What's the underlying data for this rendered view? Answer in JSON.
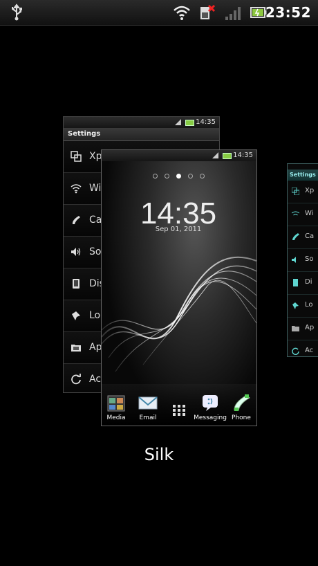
{
  "status_bar": {
    "time": "23:52"
  },
  "recent_apps": {
    "settings_card": {
      "status_time": "14:35",
      "title": "Settings",
      "items": [
        {
          "label": "Xp",
          "icon": "xperia-icon"
        },
        {
          "label": "Wi",
          "icon": "wifi-icon"
        },
        {
          "label": "Ca",
          "icon": "call-icon"
        },
        {
          "label": "So",
          "icon": "sound-icon"
        },
        {
          "label": "Dis",
          "icon": "display-icon"
        },
        {
          "label": "Lo",
          "icon": "location-icon"
        },
        {
          "label": "Ap",
          "icon": "apps-icon"
        },
        {
          "label": "Ac",
          "icon": "sync-icon"
        }
      ]
    },
    "home_card": {
      "status_time": "14:35",
      "clock": "14:35",
      "date": "Sep 01, 2011",
      "dock": [
        {
          "label": "Media",
          "icon": "media-folder-icon"
        },
        {
          "label": "Email",
          "icon": "email-icon"
        },
        {
          "label": "",
          "icon": "app-drawer-icon"
        },
        {
          "label": "Messaging",
          "icon": "messaging-icon"
        },
        {
          "label": "Phone",
          "icon": "phone-icon"
        }
      ]
    },
    "right_card": {
      "title": "Settings",
      "items": [
        {
          "label": "Xp"
        },
        {
          "label": "Wi"
        },
        {
          "label": "Ca"
        },
        {
          "label": "So"
        },
        {
          "label": "Di"
        },
        {
          "label": "Lo"
        },
        {
          "label": "Ap"
        },
        {
          "label": "Ac"
        }
      ]
    },
    "selected_app_label": "Silk"
  },
  "colors": {
    "accent_teal": "#5fd6d0",
    "battery_green": "#8cc63f"
  }
}
